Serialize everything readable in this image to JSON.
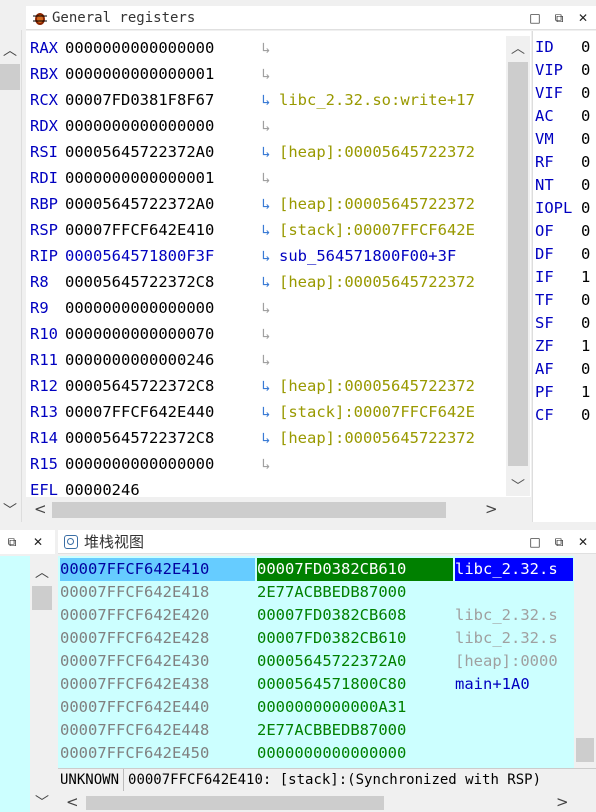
{
  "registers_panel": {
    "title": "General registers",
    "registers": [
      {
        "name": "RAX",
        "value": "0000000000000000",
        "arrow": "grey",
        "symbol": ""
      },
      {
        "name": "RBX",
        "value": "0000000000000001",
        "arrow": "grey",
        "symbol": ""
      },
      {
        "name": "RCX",
        "value": "00007FD0381F8F67",
        "arrow": "blue",
        "symbol": "libc_2.32.so:write+17",
        "symbol_color": "olive"
      },
      {
        "name": "RDX",
        "value": "0000000000000000",
        "arrow": "grey",
        "symbol": ""
      },
      {
        "name": "RSI",
        "value": "00005645722372A0",
        "arrow": "blue",
        "symbol": "[heap]:00005645722372",
        "symbol_color": "olive"
      },
      {
        "name": "RDI",
        "value": "0000000000000001",
        "arrow": "grey",
        "symbol": ""
      },
      {
        "name": "RBP",
        "value": "00005645722372A0",
        "arrow": "blue",
        "symbol": "[heap]:00005645722372",
        "symbol_color": "olive"
      },
      {
        "name": "RSP",
        "value": "00007FFCF642E410",
        "arrow": "blue",
        "symbol": "[stack]:00007FFCF642E",
        "symbol_color": "olive"
      },
      {
        "name": "RIP",
        "value": "0000564571800F3F",
        "arrow": "blue",
        "symbol": "sub_564571800F00+3F",
        "symbol_color": "blue",
        "value_color": "blue"
      },
      {
        "name": "R8",
        "value": "00005645722372C8",
        "arrow": "blue",
        "symbol": "[heap]:00005645722372",
        "symbol_color": "olive"
      },
      {
        "name": "R9",
        "value": "0000000000000000",
        "arrow": "grey",
        "symbol": ""
      },
      {
        "name": "R10",
        "value": "0000000000000070",
        "arrow": "grey",
        "symbol": ""
      },
      {
        "name": "R11",
        "value": "0000000000000246",
        "arrow": "grey",
        "symbol": ""
      },
      {
        "name": "R12",
        "value": "00005645722372C8",
        "arrow": "blue",
        "symbol": "[heap]:00005645722372",
        "symbol_color": "olive"
      },
      {
        "name": "R13",
        "value": "00007FFCF642E440",
        "arrow": "blue",
        "symbol": "[stack]:00007FFCF642E",
        "symbol_color": "olive"
      },
      {
        "name": "R14",
        "value": "00005645722372C8",
        "arrow": "blue",
        "symbol": "[heap]:00005645722372",
        "symbol_color": "olive"
      },
      {
        "name": "R15",
        "value": "0000000000000000",
        "arrow": "grey",
        "symbol": ""
      },
      {
        "name": "EFL",
        "value": "00000246",
        "arrow": "none",
        "symbol": ""
      }
    ],
    "flags": [
      {
        "name": "ID",
        "value": "0"
      },
      {
        "name": "VIP",
        "value": "0"
      },
      {
        "name": "VIF",
        "value": "0"
      },
      {
        "name": "AC",
        "value": "0"
      },
      {
        "name": "VM",
        "value": "0"
      },
      {
        "name": "RF",
        "value": "0"
      },
      {
        "name": "NT",
        "value": "0"
      },
      {
        "name": "IOPL",
        "value": "0"
      },
      {
        "name": "OF",
        "value": "0"
      },
      {
        "name": "DF",
        "value": "0"
      },
      {
        "name": "IF",
        "value": "1"
      },
      {
        "name": "TF",
        "value": "0"
      },
      {
        "name": "SF",
        "value": "0"
      },
      {
        "name": "ZF",
        "value": "1"
      },
      {
        "name": "AF",
        "value": "0"
      },
      {
        "name": "PF",
        "value": "1"
      },
      {
        "name": "CF",
        "value": "0"
      }
    ]
  },
  "stack_panel": {
    "title": "堆栈视图",
    "rows": [
      {
        "addr": "00007FFCF642E410",
        "value": "00007FD0382CB610",
        "comment": "libc_2.32.s",
        "comment_color": "selected",
        "selected": true
      },
      {
        "addr": "00007FFCF642E418",
        "value": "2E77ACBBEDB87000",
        "comment": "",
        "comment_color": "grey"
      },
      {
        "addr": "00007FFCF642E420",
        "value": "00007FD0382CB608",
        "comment": "libc_2.32.s",
        "comment_color": "grey"
      },
      {
        "addr": "00007FFCF642E428",
        "value": "00007FD0382CB610",
        "comment": "libc_2.32.s",
        "comment_color": "grey"
      },
      {
        "addr": "00007FFCF642E430",
        "value": "00005645722372A0",
        "comment": "[heap]:0000",
        "comment_color": "grey"
      },
      {
        "addr": "00007FFCF642E438",
        "value": "0000564571800C80",
        "comment": "main+1A0",
        "comment_color": "blue"
      },
      {
        "addr": "00007FFCF642E440",
        "value": "0000000000000A31",
        "comment": "",
        "comment_color": "grey"
      },
      {
        "addr": "00007FFCF642E448",
        "value": "2E77ACBBEDB87000",
        "comment": "",
        "comment_color": "grey"
      },
      {
        "addr": "00007FFCF642E450",
        "value": "0000000000000000",
        "comment": "",
        "comment_color": "grey"
      }
    ],
    "status": {
      "segment": "UNKNOWN",
      "text": "00007FFCF642E410: [stack]:(Synchronized with RSP)"
    }
  },
  "colors": {
    "stack_bg": "#ccffff",
    "selected_bg": "#0000ff",
    "addr_selected_bg": "#66ccff",
    "val_selected_bg": "#008000"
  }
}
